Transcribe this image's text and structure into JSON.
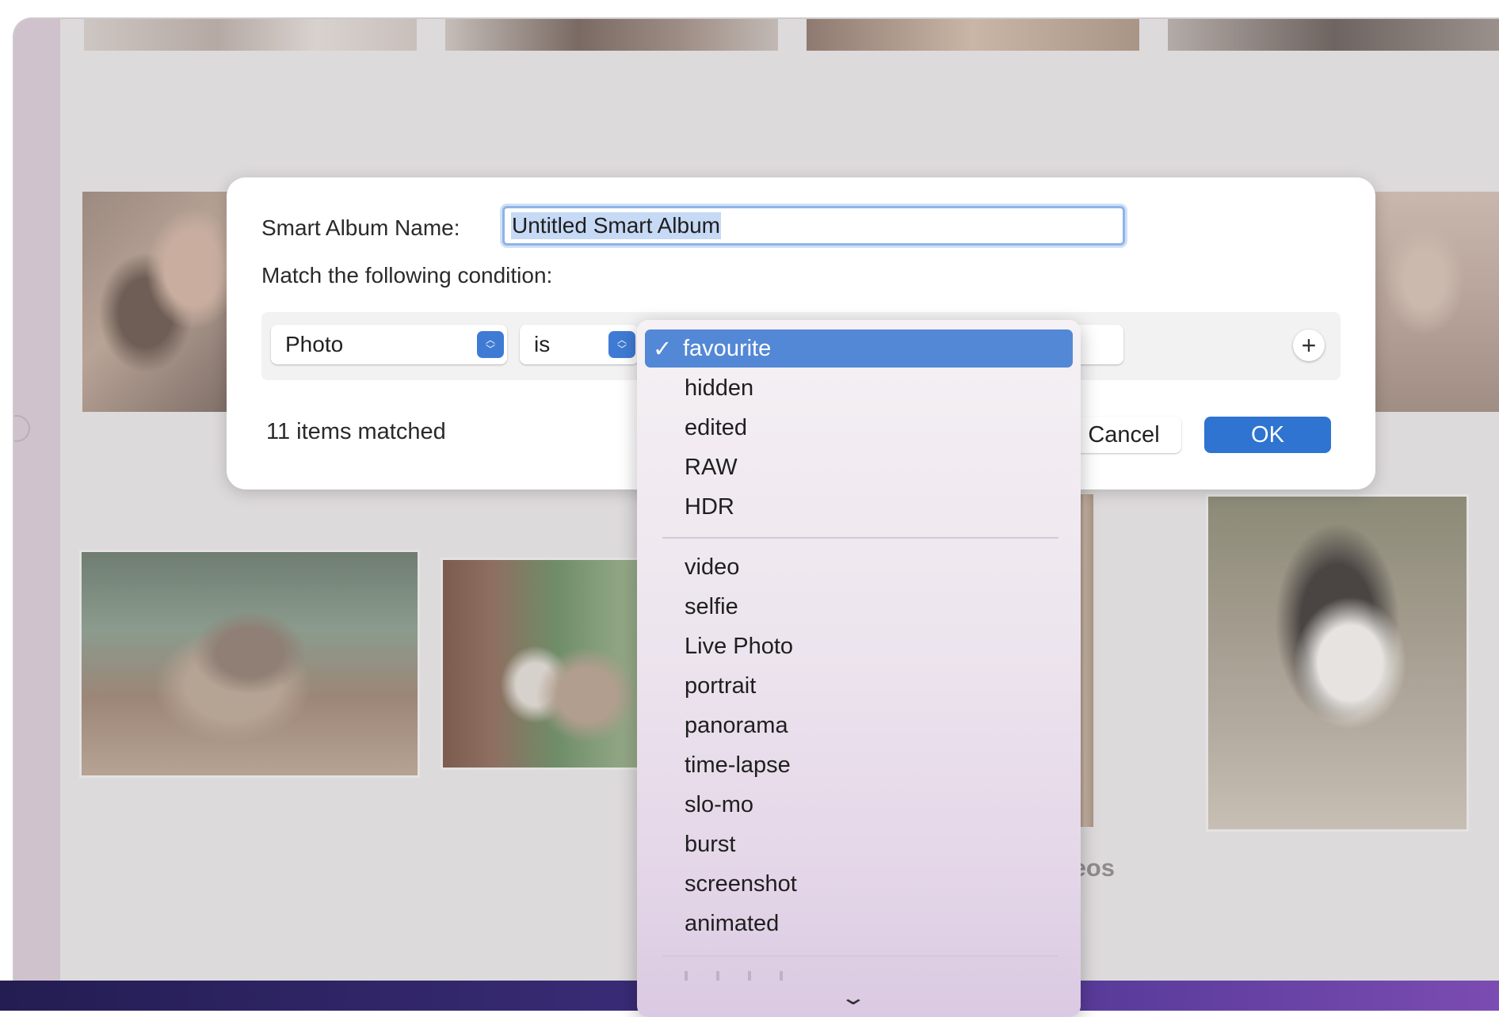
{
  "dialog": {
    "name_label": "Smart Album Name:",
    "name_value": "Untitled Smart Album",
    "match_label": "Match the following condition:",
    "condition": {
      "field": "Photo",
      "operator": "is",
      "value": "favourite"
    },
    "add_condition_label": "+",
    "matched_count": "11 items matched",
    "cancel_label": "Cancel",
    "ok_label": "OK"
  },
  "menu": {
    "selected_check": "✓",
    "group1": [
      "favourite",
      "hidden",
      "edited",
      "RAW",
      "HDR"
    ],
    "group2": [
      "video",
      "selfie",
      "Live Photo",
      "portrait",
      "panorama",
      "time-lapse",
      "slo-mo",
      "burst",
      "screenshot",
      "animated"
    ],
    "scroll_indicator": "⌄"
  },
  "background": {
    "album_label_partial": "leos"
  },
  "colors": {
    "accent": "#2e74d0",
    "menu_highlight": "#5388d6",
    "focus_ring": "#8eb4e8"
  }
}
